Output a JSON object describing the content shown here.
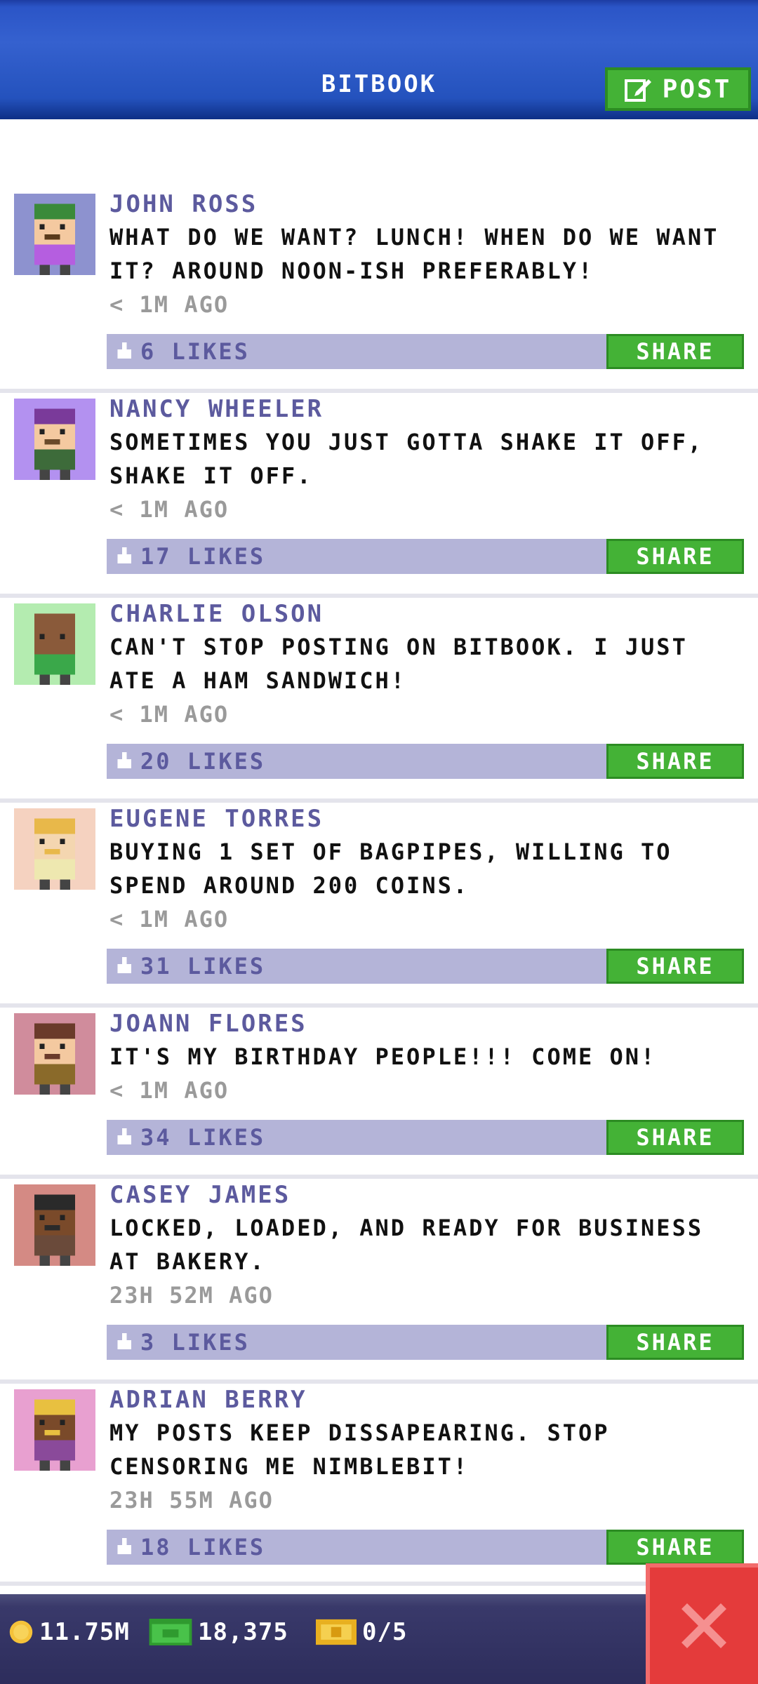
{
  "header": {
    "title": "BITBOOK",
    "post_label": "POST",
    "post_icon": "edit-icon"
  },
  "posts": [
    {
      "author": "JOHN ROSS",
      "message": "WHAT DO WE WANT? LUNCH! WHEN DO WE WANT IT? AROUND NOON-ISH PREFERABLY!",
      "time": "< 1M AGO",
      "likes": "6 LIKES",
      "share": "SHARE",
      "avatar_bg": "#8d92cf",
      "hat": "#3a8a3a",
      "skin": "#f4c9a0",
      "shirt": "#b55ee0",
      "hair": "#5a3a1a"
    },
    {
      "author": "NANCY WHEELER",
      "message": "SOMETIMES YOU JUST GOTTA SHAKE IT OFF, SHAKE IT OFF.",
      "time": "< 1M AGO",
      "likes": "17 LIKES",
      "share": "SHARE",
      "avatar_bg": "#b391f0",
      "hat": "#7a3a9a",
      "skin": "#f4c9a0",
      "shirt": "#3d6b3a",
      "hair": "#6a4a2a"
    },
    {
      "author": "CHARLIE OLSON",
      "message": "CAN'T STOP POSTING ON BITBOOK. I JUST ATE A HAM SANDWICH!",
      "time": "< 1M AGO",
      "likes": "20 LIKES",
      "share": "SHARE",
      "avatar_bg": "#b4ecb0",
      "hat": "#8a5a3a",
      "skin": "#8a5a3a",
      "shirt": "#3aa84a",
      "hair": "#8a5a3a"
    },
    {
      "author": "EUGENE TORRES",
      "message": "BUYING 1 SET OF BAGPIPES, WILLING TO SPEND AROUND 200 COINS.",
      "time": "< 1M AGO",
      "likes": "31 LIKES",
      "share": "SHARE",
      "avatar_bg": "#f5d2c0",
      "hat": "#e8b84a",
      "skin": "#f4d6b0",
      "shirt": "#eee8b0",
      "hair": "#e8b84a"
    },
    {
      "author": "JOANN FLORES",
      "message": "IT'S MY BIRTHDAY PEOPLE!!! COME ON!",
      "time": "< 1M AGO",
      "likes": "34 LIKES",
      "share": "SHARE",
      "avatar_bg": "#d08c9c",
      "hat": "#6a3a2a",
      "skin": "#f4c9a0",
      "shirt": "#8a6a2a",
      "hair": "#6a3a2a"
    },
    {
      "author": "CASEY JAMES",
      "message": "LOCKED, LOADED, AND READY FOR BUSINESS AT BAKERY.",
      "time": "23H 52M AGO",
      "likes": "3 LIKES",
      "share": "SHARE",
      "avatar_bg": "#d48a84",
      "hat": "#2a2a2a",
      "skin": "#7a4a2a",
      "shirt": "#6a4a3a",
      "hair": "#2a2a2a"
    },
    {
      "author": "ADRIAN BERRY",
      "message": "MY POSTS KEEP DISSAPEARING. STOP CENSORING ME NIMBLEBIT!",
      "time": "23H 55M AGO",
      "likes": "18 LIKES",
      "share": "SHARE",
      "avatar_bg": "#e8a0d0",
      "hat": "#e8c040",
      "skin": "#7a4a2a",
      "shirt": "#8a4a9a",
      "hair": "#e8c040"
    }
  ],
  "status": {
    "coins": "11.75M",
    "bux": "18,375",
    "tickets": "0/5"
  },
  "colors": {
    "header_blue": "#2b55c7",
    "share_green": "#44b236",
    "bar_lavender": "#b4b4d8",
    "author_purple": "#5c5a9e",
    "close_red": "#e43b3b"
  }
}
